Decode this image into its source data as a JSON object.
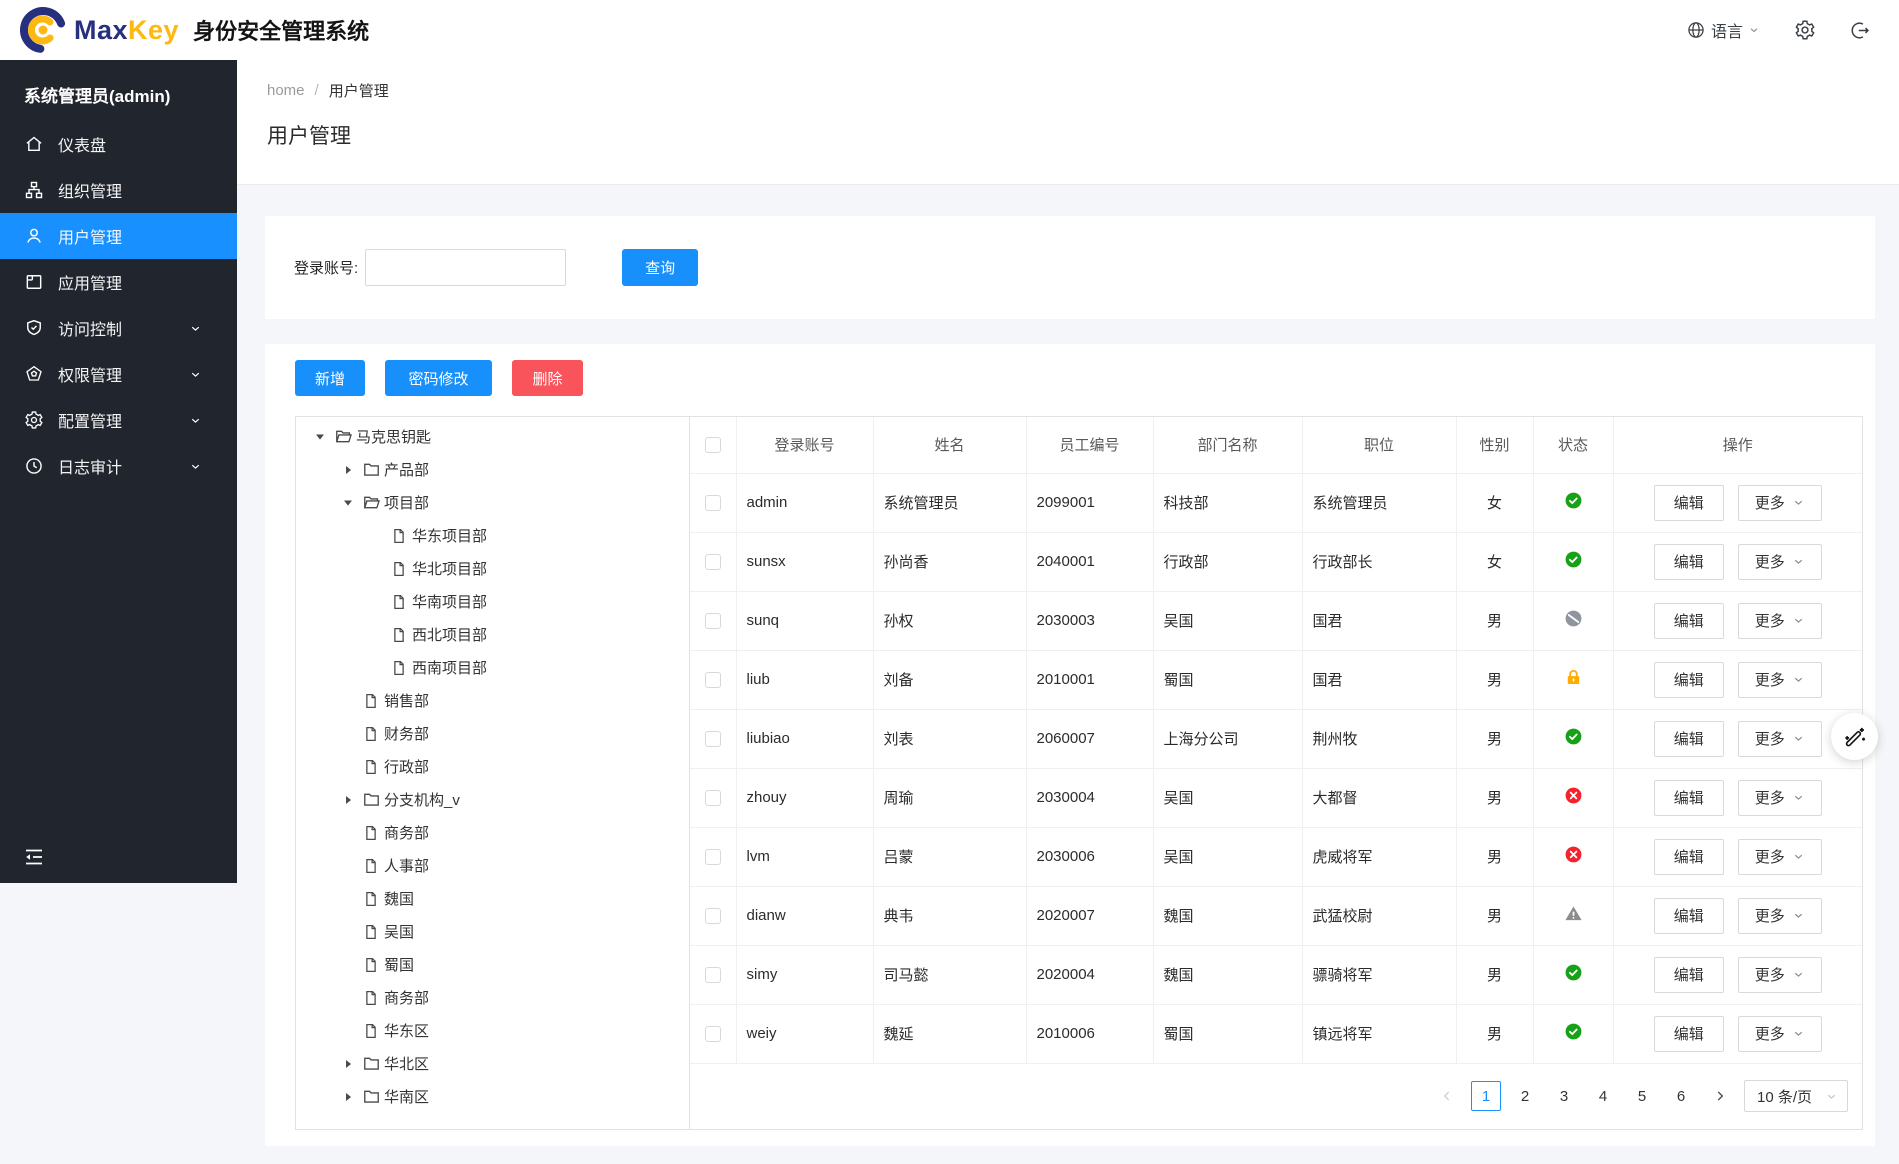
{
  "header": {
    "brand_max": "Max",
    "brand_key": "Key",
    "app_title": "身份安全管理系统",
    "language_label": "语言",
    "icons": [
      "globe-icon",
      "gear-icon",
      "logout-icon"
    ]
  },
  "sidebar": {
    "user_label": "系统管理员(admin)",
    "items": [
      {
        "id": "dashboard",
        "label": "仪表盘",
        "icon": "home-icon",
        "active": false,
        "arrow": false
      },
      {
        "id": "organization",
        "label": "组织管理",
        "icon": "org-icon",
        "active": false,
        "arrow": false
      },
      {
        "id": "users",
        "label": "用户管理",
        "icon": "user-icon",
        "active": true,
        "arrow": false
      },
      {
        "id": "applications",
        "label": "应用管理",
        "icon": "app-icon",
        "active": false,
        "arrow": false
      },
      {
        "id": "access",
        "label": "访问控制",
        "icon": "shield-icon",
        "active": false,
        "arrow": true
      },
      {
        "id": "permissions",
        "label": "权限管理",
        "icon": "gem-icon",
        "active": false,
        "arrow": true
      },
      {
        "id": "config",
        "label": "配置管理",
        "icon": "gear-icon",
        "active": false,
        "arrow": true
      },
      {
        "id": "audit",
        "label": "日志审计",
        "icon": "clock-icon",
        "active": false,
        "arrow": true
      }
    ]
  },
  "breadcrumb": {
    "home": "home",
    "separator": "/",
    "current": "用户管理"
  },
  "page_title": "用户管理",
  "search": {
    "label": "登录账号:",
    "value": "",
    "button": "查询"
  },
  "toolbar": {
    "add": "新增",
    "change_password": "密码修改",
    "delete": "删除"
  },
  "tree": {
    "nodes": [
      {
        "label": "马克思钥匙",
        "level": 0,
        "icon": "folder-open-icon",
        "caret": "down"
      },
      {
        "label": "产品部",
        "level": 1,
        "icon": "folder-icon",
        "caret": "right"
      },
      {
        "label": "项目部",
        "level": 1,
        "icon": "folder-open-icon",
        "caret": "down"
      },
      {
        "label": "华东项目部",
        "level": 2,
        "icon": "file-icon",
        "caret": "none"
      },
      {
        "label": "华北项目部",
        "level": 2,
        "icon": "file-icon",
        "caret": "none"
      },
      {
        "label": "华南项目部",
        "level": 2,
        "icon": "file-icon",
        "caret": "none"
      },
      {
        "label": "西北项目部",
        "level": 2,
        "icon": "file-icon",
        "caret": "none"
      },
      {
        "label": "西南项目部",
        "level": 2,
        "icon": "file-icon",
        "caret": "none"
      },
      {
        "label": "销售部",
        "level": 1,
        "icon": "file-icon",
        "caret": "none"
      },
      {
        "label": "财务部",
        "level": 1,
        "icon": "file-icon",
        "caret": "none"
      },
      {
        "label": "行政部",
        "level": 1,
        "icon": "file-icon",
        "caret": "none"
      },
      {
        "label": "分支机构_v",
        "level": 1,
        "icon": "folder-icon",
        "caret": "right"
      },
      {
        "label": "商务部",
        "level": 1,
        "icon": "file-icon",
        "caret": "none"
      },
      {
        "label": "人事部",
        "level": 1,
        "icon": "file-icon",
        "caret": "none"
      },
      {
        "label": "魏国",
        "level": 1,
        "icon": "file-icon",
        "caret": "none"
      },
      {
        "label": "吴国",
        "level": 1,
        "icon": "file-icon",
        "caret": "none"
      },
      {
        "label": "蜀国",
        "level": 1,
        "icon": "file-icon",
        "caret": "none"
      },
      {
        "label": "商务部",
        "level": 1,
        "icon": "file-icon",
        "caret": "none"
      },
      {
        "label": "华东区",
        "level": 1,
        "icon": "file-icon",
        "caret": "none"
      },
      {
        "label": "华北区",
        "level": 1,
        "icon": "folder-icon",
        "caret": "right"
      },
      {
        "label": "华南区",
        "level": 1,
        "icon": "folder-icon",
        "caret": "right"
      }
    ]
  },
  "table": {
    "columns": [
      "登录账号",
      "姓名",
      "员工编号",
      "部门名称",
      "职位",
      "性别",
      "状态",
      "操作"
    ],
    "edit_label": "编辑",
    "more_label": "更多",
    "rows": [
      {
        "login": "admin",
        "name": "系统管理员",
        "employee_no": "2099001",
        "department": "科技部",
        "position": "系统管理员",
        "gender": "女",
        "status": "active"
      },
      {
        "login": "sunsx",
        "name": "孙尚香",
        "employee_no": "2040001",
        "department": "行政部",
        "position": "行政部长",
        "gender": "女",
        "status": "active"
      },
      {
        "login": "sunq",
        "name": "孙权",
        "employee_no": "2030003",
        "department": "吴国",
        "position": "国君",
        "gender": "男",
        "status": "disabled"
      },
      {
        "login": "liub",
        "name": "刘备",
        "employee_no": "2010001",
        "department": "蜀国",
        "position": "国君",
        "gender": "男",
        "status": "locked"
      },
      {
        "login": "liubiao",
        "name": "刘表",
        "employee_no": "2060007",
        "department": "上海分公司",
        "position": "荆州牧",
        "gender": "男",
        "status": "active"
      },
      {
        "login": "zhouy",
        "name": "周瑜",
        "employee_no": "2030004",
        "department": "吴国",
        "position": "大都督",
        "gender": "男",
        "status": "inactive"
      },
      {
        "login": "lvm",
        "name": "吕蒙",
        "employee_no": "2030006",
        "department": "吴国",
        "position": "虎威将军",
        "gender": "男",
        "status": "inactive"
      },
      {
        "login": "dianw",
        "name": "典韦",
        "employee_no": "2020007",
        "department": "魏国",
        "position": "武猛校尉",
        "gender": "男",
        "status": "warning"
      },
      {
        "login": "simy",
        "name": "司马懿",
        "employee_no": "2020004",
        "department": "魏国",
        "position": "骠骑将军",
        "gender": "男",
        "status": "active"
      },
      {
        "login": "weiy",
        "name": "魏延",
        "employee_no": "2010006",
        "department": "蜀国",
        "position": "镇远将军",
        "gender": "男",
        "status": "active"
      }
    ],
    "status_icons": {
      "active": "check-circle-icon",
      "disabled": "ban-icon",
      "locked": "lock-icon",
      "inactive": "close-circle-icon",
      "warning": "warning-triangle-icon"
    }
  },
  "pagination": {
    "pages": [
      "1",
      "2",
      "3",
      "4",
      "5",
      "6"
    ],
    "active": "1",
    "page_size": "10 条/页"
  },
  "colors": {
    "primary": "#1890ff",
    "danger": "#f9545b",
    "status_green": "#16a116",
    "status_red": "#f5222d",
    "status_orange": "#ffab00",
    "status_gray": "#8f959e",
    "sidebar_bg": "#21252e",
    "page_bg": "#f4f6f9"
  }
}
